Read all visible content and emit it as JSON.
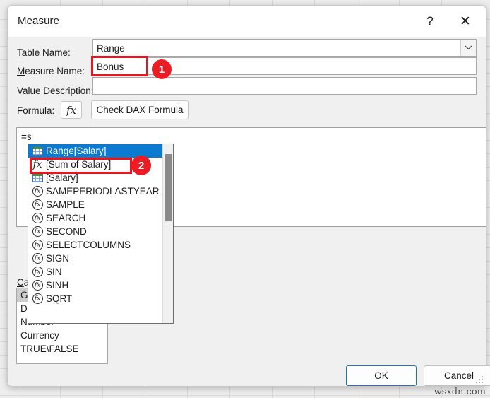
{
  "window": {
    "title": "Measure",
    "help_icon": "question-mark-icon",
    "close_icon": "close-icon"
  },
  "form": {
    "table_name_label": "Table Name:",
    "table_name_value": "Range",
    "table_name_dropdown_icon": "chevron-down-icon",
    "measure_name_label": "Measure Name:",
    "measure_name_value": "Bonus",
    "value_description_label": "Value Description:",
    "value_description_value": "",
    "formula_label": "Formula:",
    "fx_button_label": "fx",
    "check_dax_label": "Check DAX Formula",
    "formula_value": "=s",
    "category_label": "Category:"
  },
  "categories": [
    {
      "label": "General",
      "selected": true
    },
    {
      "label": "Date",
      "selected": false
    },
    {
      "label": "Number",
      "selected": false
    },
    {
      "label": "Currency",
      "selected": false
    },
    {
      "label": "TRUE\\FALSE",
      "selected": false
    }
  ],
  "autocomplete": {
    "items": [
      {
        "label": "Range[Salary]",
        "icon": "table-icon",
        "selected": true
      },
      {
        "label": "[Sum of Salary]",
        "icon": "measure-fx-icon",
        "selected": false
      },
      {
        "label": "[Salary]",
        "icon": "table-icon",
        "selected": false
      },
      {
        "label": "SAMEPERIODLASTYEAR",
        "icon": "function-fx-icon",
        "selected": false
      },
      {
        "label": "SAMPLE",
        "icon": "function-fx-icon",
        "selected": false
      },
      {
        "label": "SEARCH",
        "icon": "function-fx-icon",
        "selected": false
      },
      {
        "label": "SECOND",
        "icon": "function-fx-icon",
        "selected": false
      },
      {
        "label": "SELECTCOLUMNS",
        "icon": "function-fx-icon",
        "selected": false
      },
      {
        "label": "SIGN",
        "icon": "function-fx-icon",
        "selected": false
      },
      {
        "label": "SIN",
        "icon": "function-fx-icon",
        "selected": false
      },
      {
        "label": "SINH",
        "icon": "function-fx-icon",
        "selected": false
      },
      {
        "label": "SQRT",
        "icon": "function-fx-icon",
        "selected": false
      }
    ]
  },
  "callouts": [
    {
      "number": "1"
    },
    {
      "number": "2"
    }
  ],
  "footer": {
    "ok_label": "OK",
    "cancel_label": "Cancel"
  },
  "watermark": "wsxdn.com",
  "colors": {
    "selection_blue": "#0b7ad1",
    "callout_red": "#ed1c24",
    "highlight_red": "#e8161c",
    "dialog_bg": "#f0f0f0",
    "focus_blue": "#1a74b8"
  }
}
